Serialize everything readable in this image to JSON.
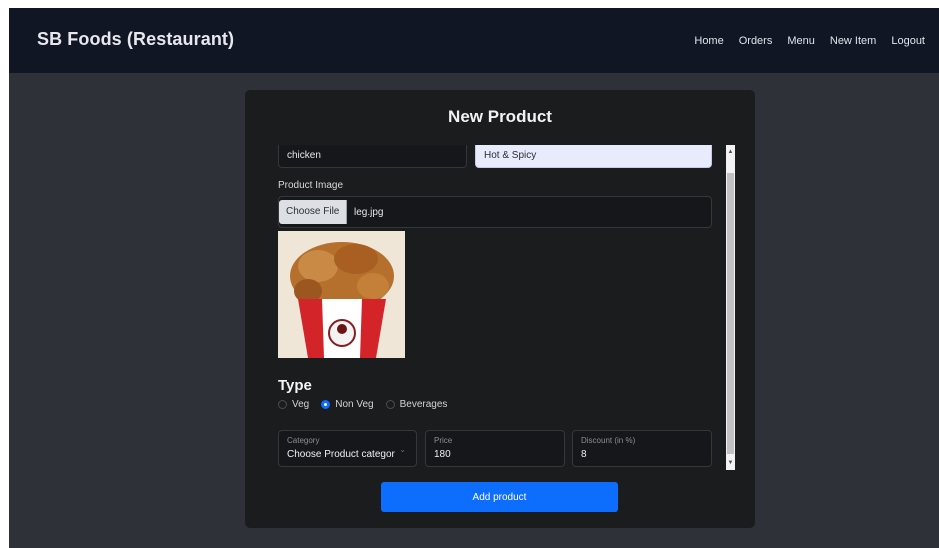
{
  "navbar": {
    "brand": "SB Foods (Restaurant)",
    "links": [
      "Home",
      "Orders",
      "Menu",
      "New Item",
      "Logout"
    ]
  },
  "form": {
    "title": "New Product",
    "fields": {
      "name_value": "chicken",
      "flavour_value": "Hot & Spicy",
      "image_label": "Product Image",
      "choose_file_label": "Choose File",
      "file_name": "leg.jpg",
      "type_heading": "Type",
      "type_options": [
        "Veg",
        "Non Veg",
        "Beverages"
      ],
      "type_selected": "Non Veg",
      "category_label": "Category",
      "category_value": "Choose Product categor",
      "price_label": "Price",
      "price_value": "180",
      "discount_label": "Discount (in %)",
      "discount_value": "8"
    },
    "submit_label": "Add product"
  },
  "colors": {
    "navbar_bg": "#101624",
    "page_bg": "#2e3137",
    "card_bg": "#1b1c1e",
    "accent": "#0d6efd"
  },
  "icons": [
    "chevron-down-icon",
    "scroll-up-arrow-icon",
    "scroll-down-arrow-icon"
  ]
}
